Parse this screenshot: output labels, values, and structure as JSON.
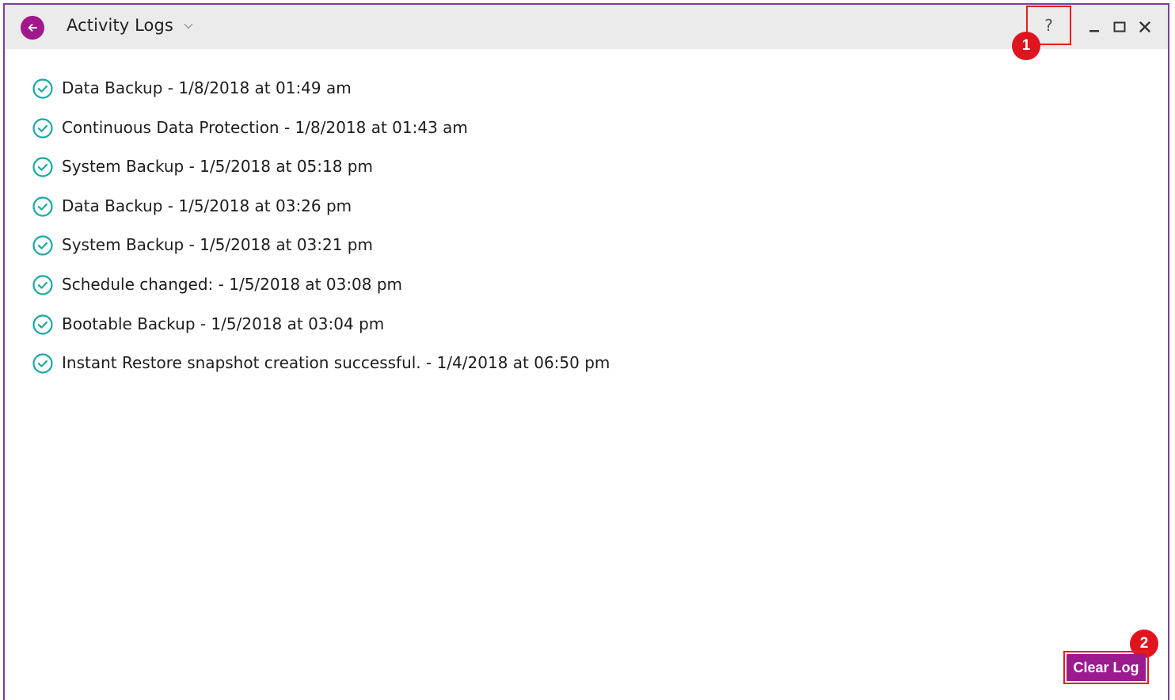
{
  "window": {
    "title": "Activity Logs",
    "help_label": "?",
    "accent_color": "#a0188c",
    "frame_color": "#7b3fa0",
    "highlight_color": "#e02020"
  },
  "icons": {
    "back": "arrow-left-icon",
    "title_dropdown": "chevron-down-icon",
    "minimize": "minimize-icon",
    "maximize": "maximize-icon",
    "close": "close-icon",
    "log_status": "check-circle-icon"
  },
  "annotations": {
    "help_badge": "1",
    "clear_badge": "2"
  },
  "logs": [
    "Data Backup - 1/8/2018 at 01:49 am",
    "Continuous Data Protection - 1/8/2018 at 01:43 am",
    "System Backup - 1/5/2018 at 05:18 pm",
    "Data Backup - 1/5/2018 at 03:26 pm",
    "System Backup - 1/5/2018 at 03:21 pm",
    "Schedule changed: - 1/5/2018 at 03:08 pm",
    "Bootable Backup - 1/5/2018 at 03:04 pm",
    "Instant Restore snapshot creation successful. - 1/4/2018 at 06:50 pm"
  ],
  "footer": {
    "clear_log_label": "Clear Log"
  }
}
